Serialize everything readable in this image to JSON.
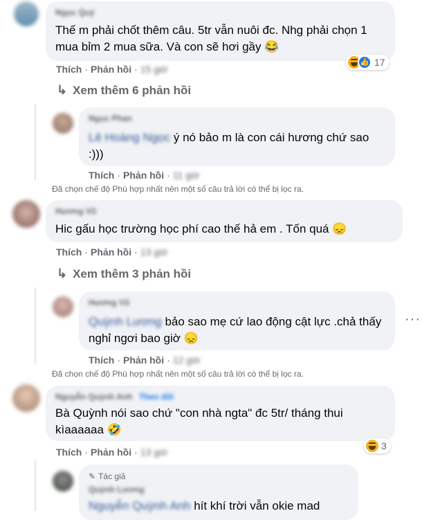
{
  "colors": {
    "bubble": "#f0f2f5",
    "secondary_text": "#65676b",
    "link": "#385898",
    "like_blue": "#1877f2",
    "haha_yellow": "#f7b125"
  },
  "comments": [
    {
      "author": "Ngọc Quý",
      "text": "Thế m phải chốt thêm câu. 5tr vẫn nuôi đc. Nhg phải chọn 1 mua bỉm 2 mua sữa. Và con sẽ hơi gầy",
      "emoji": "😂",
      "like": "Thích",
      "reply": "Phản hồi",
      "time": "15 giờ",
      "reactions": {
        "icons": [
          "haha-icon",
          "like-icon"
        ],
        "count": "17"
      },
      "more_replies": "Xem thêm 6 phản hồi"
    },
    {
      "author": "Ngọc Phan",
      "mention": "Lê Hoàng Ngọc",
      "text": "ý nó bảo m là con cái hương chứ sao :)))",
      "like": "Thích",
      "reply": "Phản hồi",
      "time": "11 giờ"
    },
    {
      "author": "Hương Vũ",
      "text": "Hic gấu học trường học phí cao thế hả em . Tốn quá",
      "emoji": "😞",
      "like": "Thích",
      "reply": "Phản hồi",
      "time": "13 giờ",
      "more_replies": "Xem thêm 3 phản hồi"
    },
    {
      "author": "Hương Vũ",
      "mention": "Quỳnh Lương",
      "text": "bảo sao mẹ cứ lao động cật lực .chả thấy nghỉ ngơi bao giờ",
      "emoji": "😞",
      "like": "Thích",
      "reply": "Phản hồi",
      "time": "12 giờ"
    },
    {
      "author": "Nguyễn Quỳnh Anh",
      "badge": "Theo dõi",
      "text": "Bà Quỳnh nói sao chứ \"con nhà ngta\" đc 5tr/ tháng thui kìaaaaaa",
      "emoji": "🤣",
      "like": "Thích",
      "reply": "Phản hồi",
      "time": "13 giờ",
      "reactions": {
        "icons": [
          "haha-icon"
        ],
        "count": "3"
      }
    },
    {
      "author_badge": "Tác giả",
      "author": "Quỳnh Lương",
      "mention": "Nguyễn Quỳnh Anh",
      "text": "hít khí trời vẫn okie mad"
    }
  ],
  "filter_note": "Đã chọn chế độ Phù hợp nhất nên một số câu trả lời có thể bị lọc ra.",
  "more_icon": "more-options-icon"
}
